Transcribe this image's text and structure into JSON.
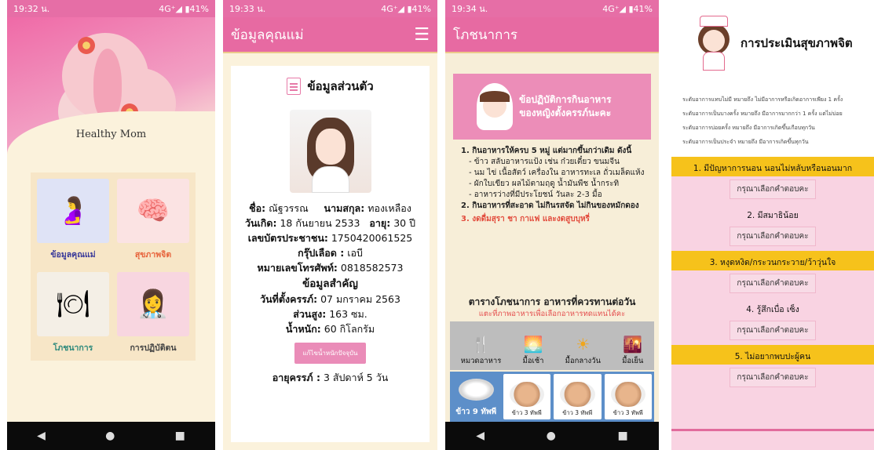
{
  "screen1": {
    "status": {
      "time": "19:32 น.",
      "network": "4G⁺◢ ▮41%"
    },
    "brand": "Healthy Mom",
    "tiles": [
      {
        "label": "ข้อมูลคุณแม่",
        "color": "#3a3a9a",
        "bg": "#dfe3f6",
        "icon": "🤰"
      },
      {
        "label": "สุขภาพจิต",
        "color": "#e7643c",
        "bg": "#fbe3e3",
        "icon": "🧠"
      },
      {
        "label": "โภชนาการ",
        "color": "#2e8a7c",
        "bg": "#f4efe6",
        "icon": "🍽"
      },
      {
        "label": "การปฏิบัติตน",
        "color": "#444444",
        "bg": "#f8d6e0",
        "icon": "👩‍⚕"
      }
    ],
    "nav": [
      "◀",
      "●",
      "■"
    ]
  },
  "screen2": {
    "status": {
      "time": "19:33 น.",
      "network": "4G⁺◢ ▮41%"
    },
    "appbar_title": "ข้อมูลคุณแม่",
    "menu_icon": "☰",
    "section_title": "ข้อมูลส่วนตัว",
    "name_label": "ชื่อ:",
    "name_value": "ณัฐวรรณ",
    "surname_label": "นามสกุล:",
    "surname_value": "ทองเหลือง",
    "dob_label": "วันเกิด:",
    "dob_value": "18 กันยายน 2533",
    "age_label": "อายุ:",
    "age_value": "30 ปี",
    "id_label": "เลขบัตรประชาชน:",
    "id_value": "1750420061525",
    "blood_label": "กรุ๊ปเลือด :",
    "blood_value": "เอบี",
    "phone_label": "หมายเลขโทรศัพท์:",
    "phone_value": "0818582573",
    "important_title": "ข้อมูลสำคัญ",
    "preg_label": "วันที่ตั้งครรภ์:",
    "preg_value": "07 มกราคม 2563",
    "height_label": "ส่วนสูง:",
    "height_value": "163 ซม.",
    "weight_label": "น้ำหนัก:",
    "weight_value": "60 กิโลกรัม",
    "edit_button": "แก้ไขน้ำหนักปัจจุบัน",
    "ga_label": "อายุครรภ์ :",
    "ga_value": "3 สัปดาห์ 5 วัน"
  },
  "screen3": {
    "status": {
      "time": "19:34 น.",
      "network": "4G⁺◢ ▮41%"
    },
    "appbar_title": "โภชนาการ",
    "banner_line1": "ข้อปฏิบัติการกินอาหาร",
    "banner_line2": "ของหญิงตั้งครรภ์นะคะ",
    "rule1": "1. กินอาหารให้ครบ 5 หมู่ แต่มากขึ้นกว่าเดิม ดังนี้",
    "rule1_items": [
      "- ข้าว สลับอาหารแป้ง เช่น ก๋วยเตี๋ยว ขนมจีน",
      "- นม ไข่ เนื้อสัตว์ เครื่องใน อาหารทะเล ถั่วเมล็ดแห้ง",
      "- ผักใบเขียว ผลไม้ตามฤดู น้ำมันพืช น้ำกระทิ",
      "- อาหารว่างที่มีประโยชน์ วันละ 2-3 มื้อ"
    ],
    "rule2": "2. กินอาหารที่สะอาด ไม่กินรสจัด ไม่กินของหมักดอง",
    "rule3": "3. งดดื่มสุรา ชา กาแฟ และงดสูบบุหรี่",
    "table_title": "ตารางโภชนาการ อาหารที่ควรทานต่อวัน",
    "table_sub": "แตะที่ภาพอาหารเพื่อเลือกอาหารทดแทนได้คะ",
    "meals": [
      {
        "icon": "🍴",
        "label": "หมวดอาหาร"
      },
      {
        "icon": "🌅",
        "label": "มื้อเช้า"
      },
      {
        "icon": "☀",
        "label": "มื้อกลางวัน"
      },
      {
        "icon": "🌇",
        "label": "มื้อเย็น"
      }
    ],
    "foods": [
      {
        "caption": "ข้าว 9 ทัพพี"
      },
      {
        "caption": "ข้าว 3 ทัพพี"
      },
      {
        "caption": "ข้าว 3 ทัพพี"
      },
      {
        "caption": "ข้าว 3 ทัพพี"
      }
    ],
    "nav": [
      "◀",
      "●",
      "■"
    ]
  },
  "screen4": {
    "title": "การประเมินสุขภาพจิต",
    "legend": [
      "ระดับอาการแทบไม่มี หมายถึง ไม่มีอาการหรือเกิดอาการเพียง 1 ครั้ง",
      "ระดับอาการเป็นบางครั้ง หมายถึง มีอาการมากกว่า 1 ครั้ง แต่ไม่บ่อย",
      "ระดับอาการบ่อยครั้ง หมายถึง มีอาการเกิดขึ้นเกือบทุกวัน",
      "ระดับอาการเป็นประจำ หมายถึง มีอาการเกิดขึ้นทุกวัน"
    ],
    "questions": [
      {
        "q": "1. มีปัญหาการนอน นอนไม่หลับหรือนอนมาก",
        "btn": "กรุณาเลือกคำตอบคะ"
      },
      {
        "q": "2. มีสมาธิน้อย",
        "btn": "กรุณาเลือกคำตอบคะ"
      },
      {
        "q": "3. หงุดหงิด/กระวนกระวาย/ว้าวุ่นใจ",
        "btn": "กรุณาเลือกคำตอบคะ"
      },
      {
        "q": "4. รู้สึกเบื่อ เซ็ง",
        "btn": "กรุณาเลือกคำตอบคะ"
      },
      {
        "q": "5. ไม่อยากพบปะผู้คน",
        "btn": "กรุณาเลือกคำตอบคะ"
      }
    ]
  }
}
